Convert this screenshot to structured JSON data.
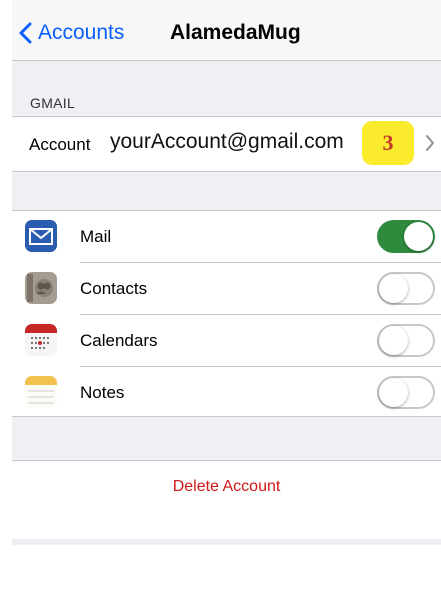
{
  "nav": {
    "back_label": "Accounts",
    "title": "AlamedaMug"
  },
  "section": {
    "header": "GMAIL"
  },
  "account": {
    "label": "Account",
    "value": "yourAccount@gmail.com",
    "badge": "3"
  },
  "services": [
    {
      "label": "Mail",
      "icon": "mail-icon",
      "enabled": true
    },
    {
      "label": "Contacts",
      "icon": "contacts-icon",
      "enabled": false
    },
    {
      "label": "Calendars",
      "icon": "calendar-icon",
      "enabled": false
    },
    {
      "label": "Notes",
      "icon": "notes-icon",
      "enabled": false
    }
  ],
  "delete": {
    "label": "Delete Account"
  },
  "colors": {
    "accent": "#0a5fff",
    "switch_on": "#2e8b3e",
    "destructive": "#d01818",
    "badge": "#fbeb2d"
  }
}
